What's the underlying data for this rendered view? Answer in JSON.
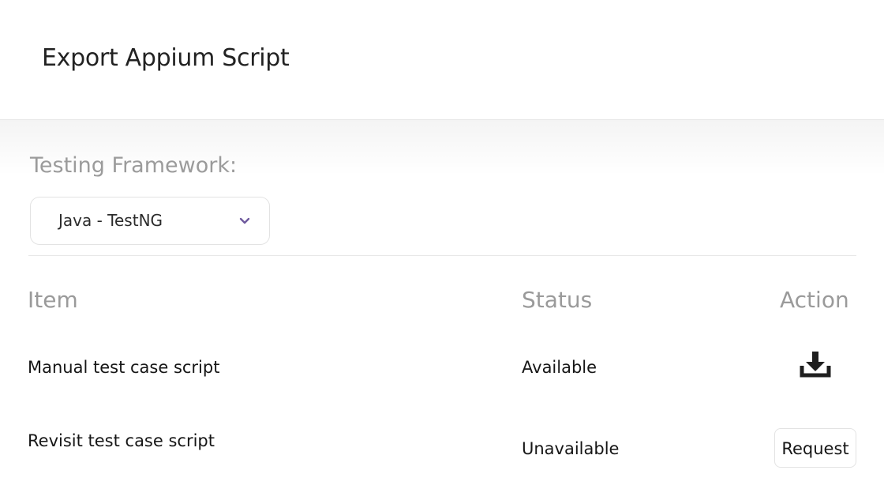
{
  "header": {
    "title": "Export Appium Script"
  },
  "framework": {
    "label": "Testing Framework:",
    "selected": "Java - TestNG"
  },
  "table": {
    "columns": {
      "item": "Item",
      "status": "Status",
      "action": "Action"
    },
    "rows": [
      {
        "item": "Manual test case script",
        "status": "Available",
        "action_icon": "download-icon"
      },
      {
        "item": "Revisit test case script",
        "status": "Unavailable",
        "action_label": "Request"
      }
    ]
  },
  "colors": {
    "chevron": "#6f5a9e",
    "icon": "#1f1f1f",
    "muted_text": "#9a9a9a"
  }
}
